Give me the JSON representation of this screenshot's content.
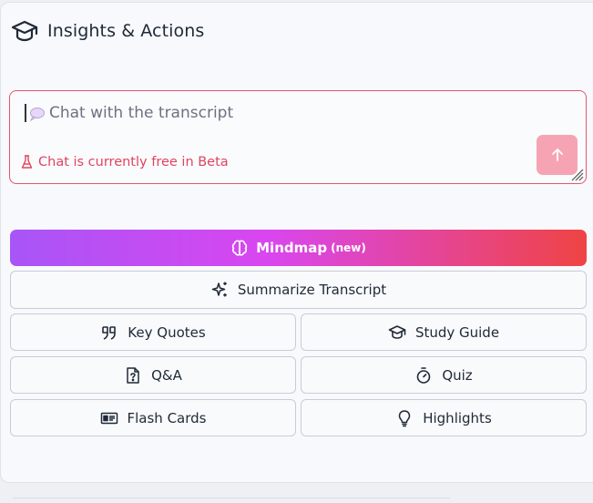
{
  "header": {
    "title": "Insights & Actions",
    "icon": "graduation-cap-icon"
  },
  "chat": {
    "placeholder": "Chat with the transcript",
    "beta_note": "Chat is currently free in Beta",
    "send_icon": "arrow-up-icon"
  },
  "actions": {
    "mindmap": {
      "label": "Mindmap",
      "tag": "(new)",
      "icon": "brain-icon"
    },
    "summarize": {
      "label": "Summarize Transcript",
      "icon": "sparkles-icon"
    },
    "key_quotes": {
      "label": "Key Quotes",
      "icon": "quote-icon"
    },
    "study_guide": {
      "label": "Study Guide",
      "icon": "graduation-cap-icon"
    },
    "qa": {
      "label": "Q&A",
      "icon": "file-question-icon"
    },
    "quiz": {
      "label": "Quiz",
      "icon": "timer-icon"
    },
    "flash_cards": {
      "label": "Flash Cards",
      "icon": "id-card-icon"
    },
    "highlights": {
      "label": "Highlights",
      "icon": "lightbulb-icon"
    }
  },
  "colors": {
    "accent_red": "#e0445f",
    "gradient_start": "#a855f7",
    "gradient_end": "#ef4444",
    "send_button": "#f6a4b3"
  }
}
